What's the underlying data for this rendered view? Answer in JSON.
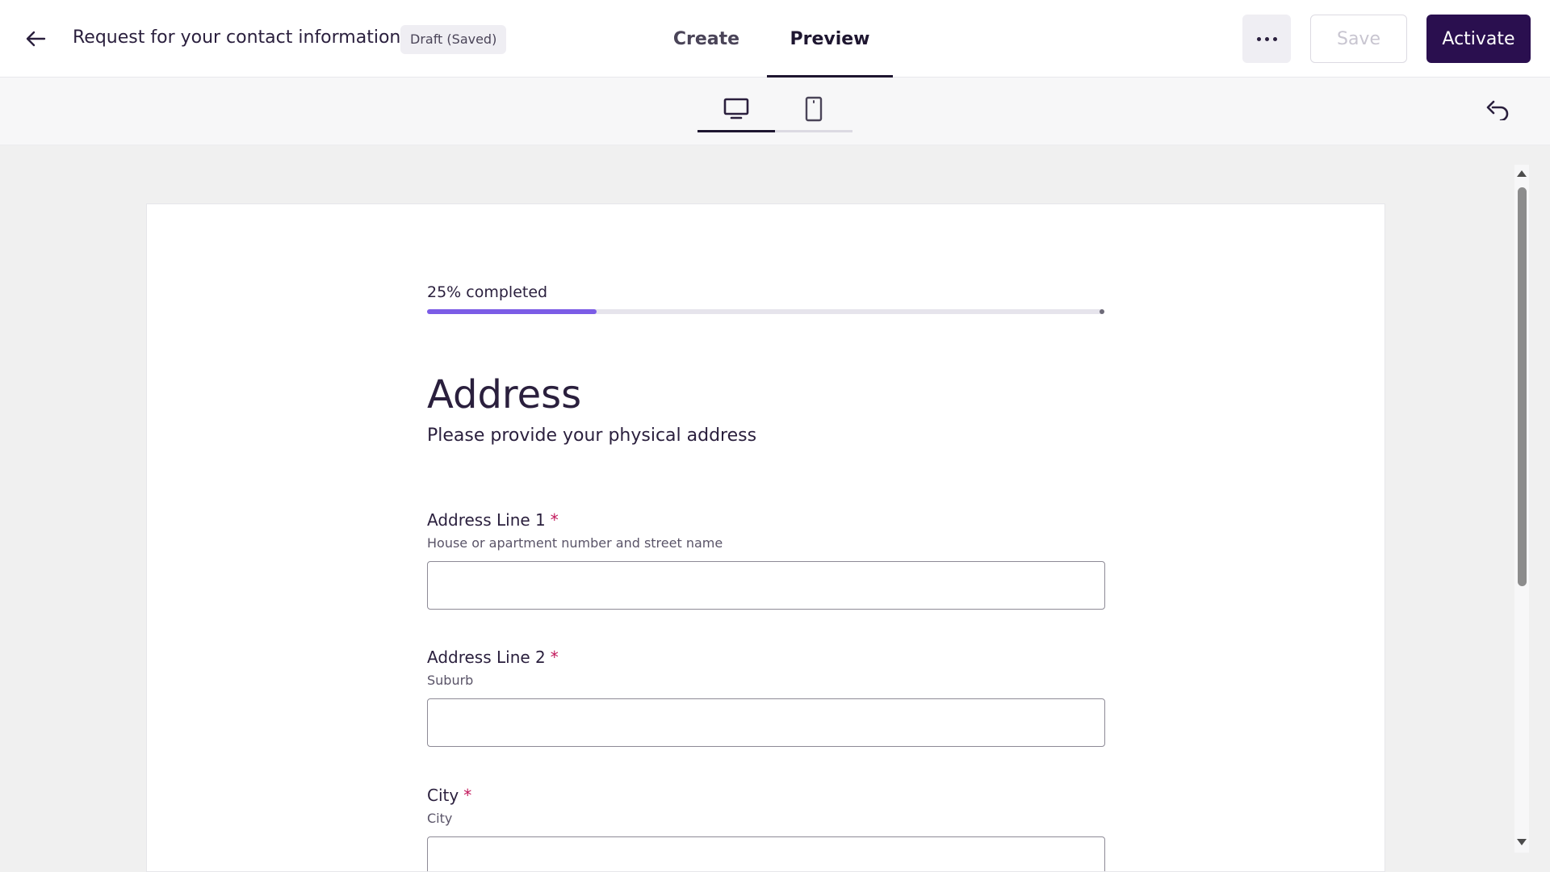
{
  "header": {
    "title": "Request for your contact information",
    "status_badge": "Draft (Saved)",
    "tabs": [
      {
        "label": "Create",
        "active": false
      },
      {
        "label": "Preview",
        "active": true
      }
    ],
    "save_label": "Save",
    "activate_label": "Activate"
  },
  "icons": {
    "back": "arrow-left-icon",
    "more": "more-horizontal-icon",
    "desktop": "monitor-icon",
    "mobile": "smartphone-icon",
    "undo": "undo-icon"
  },
  "device_toggle": {
    "options": [
      "desktop",
      "mobile"
    ],
    "selected": "desktop"
  },
  "form": {
    "progress_label": "25% completed",
    "progress_fraction": 0.25,
    "section_title": "Address",
    "section_description": "Please provide your physical address",
    "fields": [
      {
        "label": "Address Line 1",
        "required_mark": "*",
        "hint": "House or apartment number and street name",
        "value": ""
      },
      {
        "label": "Address Line 2",
        "required_mark": "*",
        "hint": "Suburb",
        "value": ""
      },
      {
        "label": "City",
        "required_mark": "*",
        "hint": "City",
        "value": ""
      }
    ]
  },
  "colors": {
    "primary": "#2a0f4f",
    "progress_fill": "#7b5ce6",
    "required": "#c2185b",
    "text": "#2a1f3d"
  }
}
